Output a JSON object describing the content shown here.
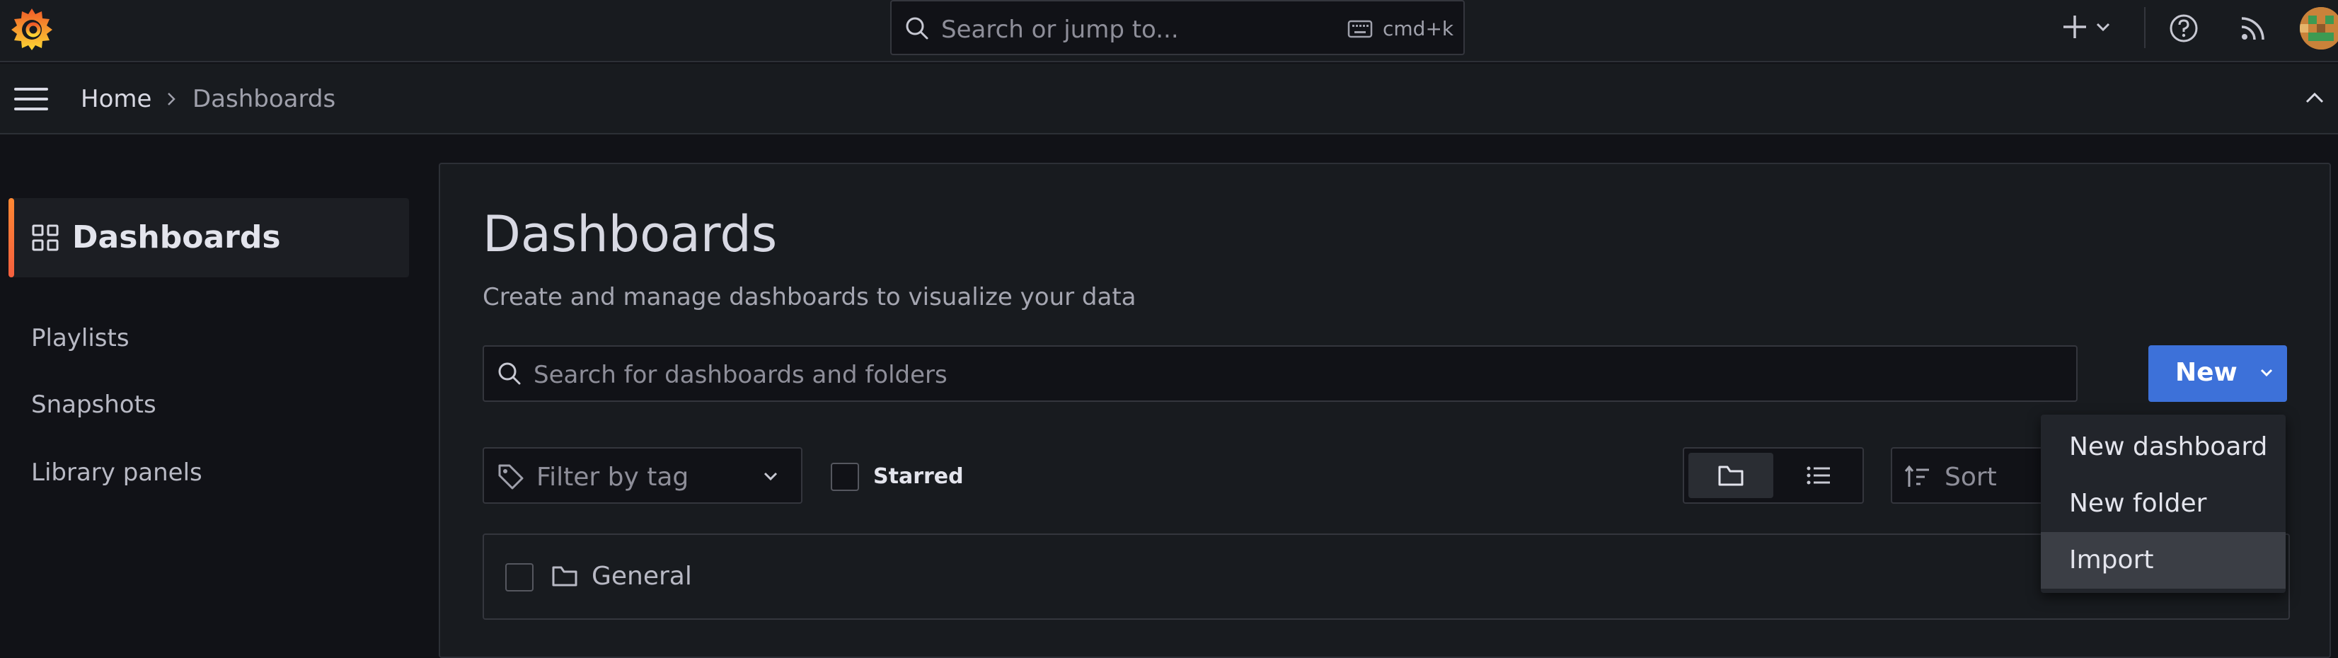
{
  "topbar": {
    "search_placeholder": "Search or jump to...",
    "search_shortcut": "cmd+k"
  },
  "breadcrumb": {
    "home": "Home",
    "current": "Dashboards"
  },
  "sidenav": {
    "active": "Dashboards",
    "items": [
      "Playlists",
      "Snapshots",
      "Library panels"
    ]
  },
  "main": {
    "title": "Dashboards",
    "subtitle": "Create and manage dashboards to visualize your data",
    "search_placeholder": "Search for dashboards and folders",
    "new_button": "New",
    "filter_tag": "Filter by tag",
    "starred_label": "Starred",
    "sort_label": "Sort",
    "folders": [
      {
        "name": "General"
      }
    ]
  },
  "new_menu": {
    "items": [
      "New dashboard",
      "New folder",
      "Import"
    ],
    "highlighted": "Import"
  },
  "colors": {
    "accent_orange": "#ff8833",
    "primary_blue": "#3d71d9",
    "background": "#111217",
    "panel": "#181b1f"
  }
}
